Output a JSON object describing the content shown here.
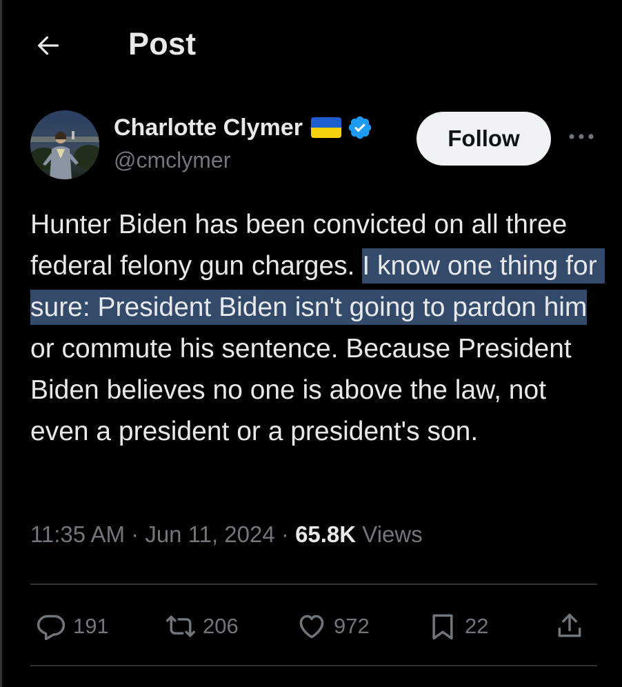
{
  "header": {
    "title": "Post",
    "back_icon": "arrow-left-icon"
  },
  "author": {
    "name": "Charlotte Clymer",
    "handle": "@cmclymer",
    "flag_icon": "ukraine-flag-icon",
    "verified_icon": "verified-badge-icon",
    "verified_color": "#1d9bf0"
  },
  "follow_button": {
    "label": "Follow"
  },
  "tweet": {
    "text_before": "Hunter Biden has been convicted on all three federal felony gun charges. ",
    "text_highlighted": "I know one thing for sure: President Biden isn't going to pardon him",
    "text_after": " or commute his sentence. Because President Biden believes no one is above the law, not even a president or a president's son.",
    "highlight_color": "#334a6b"
  },
  "meta": {
    "time": "11:35 AM",
    "separator": "·",
    "date": "Jun 11, 2024",
    "views_count": "65.8K",
    "views_label": "Views"
  },
  "actions": {
    "replies": "191",
    "reposts": "206",
    "likes": "972",
    "bookmarks": "22"
  },
  "colors": {
    "background": "#000000",
    "text_primary": "#e7e9ea",
    "text_secondary": "#71767b",
    "border": "#2f3336",
    "follow_bg": "#eff3f4"
  }
}
